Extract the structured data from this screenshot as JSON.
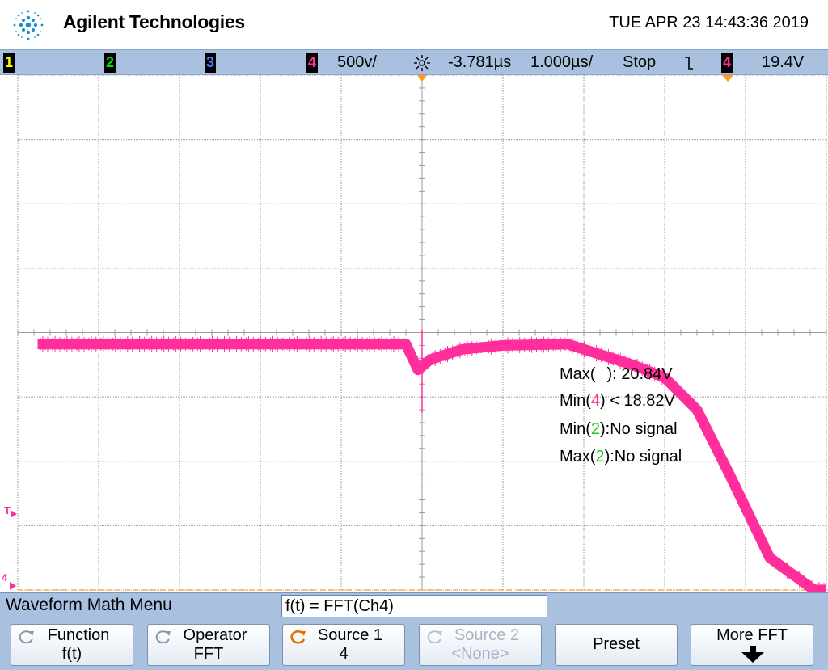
{
  "header": {
    "brand": "Agilent Technologies",
    "datetime": "TUE APR 23 14:43:36 2019"
  },
  "statusbar": {
    "channels": [
      "1",
      "2",
      "3",
      "4"
    ],
    "ch4_scale": "500v/",
    "time_delay": "-3.781µs",
    "time_scale": "1.000µs/",
    "run_state": "Stop",
    "trigger_slope": "ℒ",
    "trigger_source": "4",
    "trigger_level": "19.4V",
    "colors": {
      "ch1": "#ffff00",
      "ch2": "#00e000",
      "ch3": "#4a7dff",
      "ch4": "#ff2e9a"
    }
  },
  "graticule": {
    "trigger_marker": "T",
    "ground_marker": "4"
  },
  "measurements": {
    "max4_label_pre": "Max(",
    "max4_label_post": "): 20.84V",
    "min4_label_pre": "Min(",
    "min4_channel": "4",
    "min4_label_post": ") < 18.82V",
    "min2_label_pre": "Min(",
    "min2_channel": "2",
    "min2_label_post": "):No signal",
    "max2_label_pre": "Max(",
    "max2_channel": "2",
    "max2_label_post": "):No signal"
  },
  "menu": {
    "title": "Waveform Math Menu",
    "formula": "f(t) = FFT(Ch4)",
    "softkeys": [
      {
        "line1": "Function",
        "line2": "f(t)"
      },
      {
        "line1": "Operator",
        "line2": "FFT"
      },
      {
        "line1": "Source 1",
        "line2": "4"
      },
      {
        "line1": "Source 2",
        "line2": "<None>"
      },
      {
        "line1": "Preset",
        "line2": ""
      },
      {
        "line1": "More FFT",
        "line2": ""
      }
    ]
  },
  "chart_data": {
    "type": "line",
    "series": [
      {
        "values_divs": [
          [
            -4.75,
            0.18
          ],
          [
            -0.2,
            0.18
          ],
          [
            -0.05,
            0.58
          ],
          [
            0.1,
            0.42
          ],
          [
            0.5,
            0.26
          ],
          [
            1.0,
            0.2
          ],
          [
            1.8,
            0.18
          ],
          [
            2.6,
            0.5
          ],
          [
            3.0,
            0.7
          ],
          [
            3.4,
            1.2
          ],
          [
            3.8,
            2.2
          ],
          [
            4.3,
            3.5
          ],
          [
            4.85,
            4.0
          ],
          [
            5.0,
            4.0
          ]
        ]
      }
    ],
    "xlim": [
      -5,
      5
    ],
    "ylim": [
      -4,
      4
    ],
    "grid": true
  }
}
